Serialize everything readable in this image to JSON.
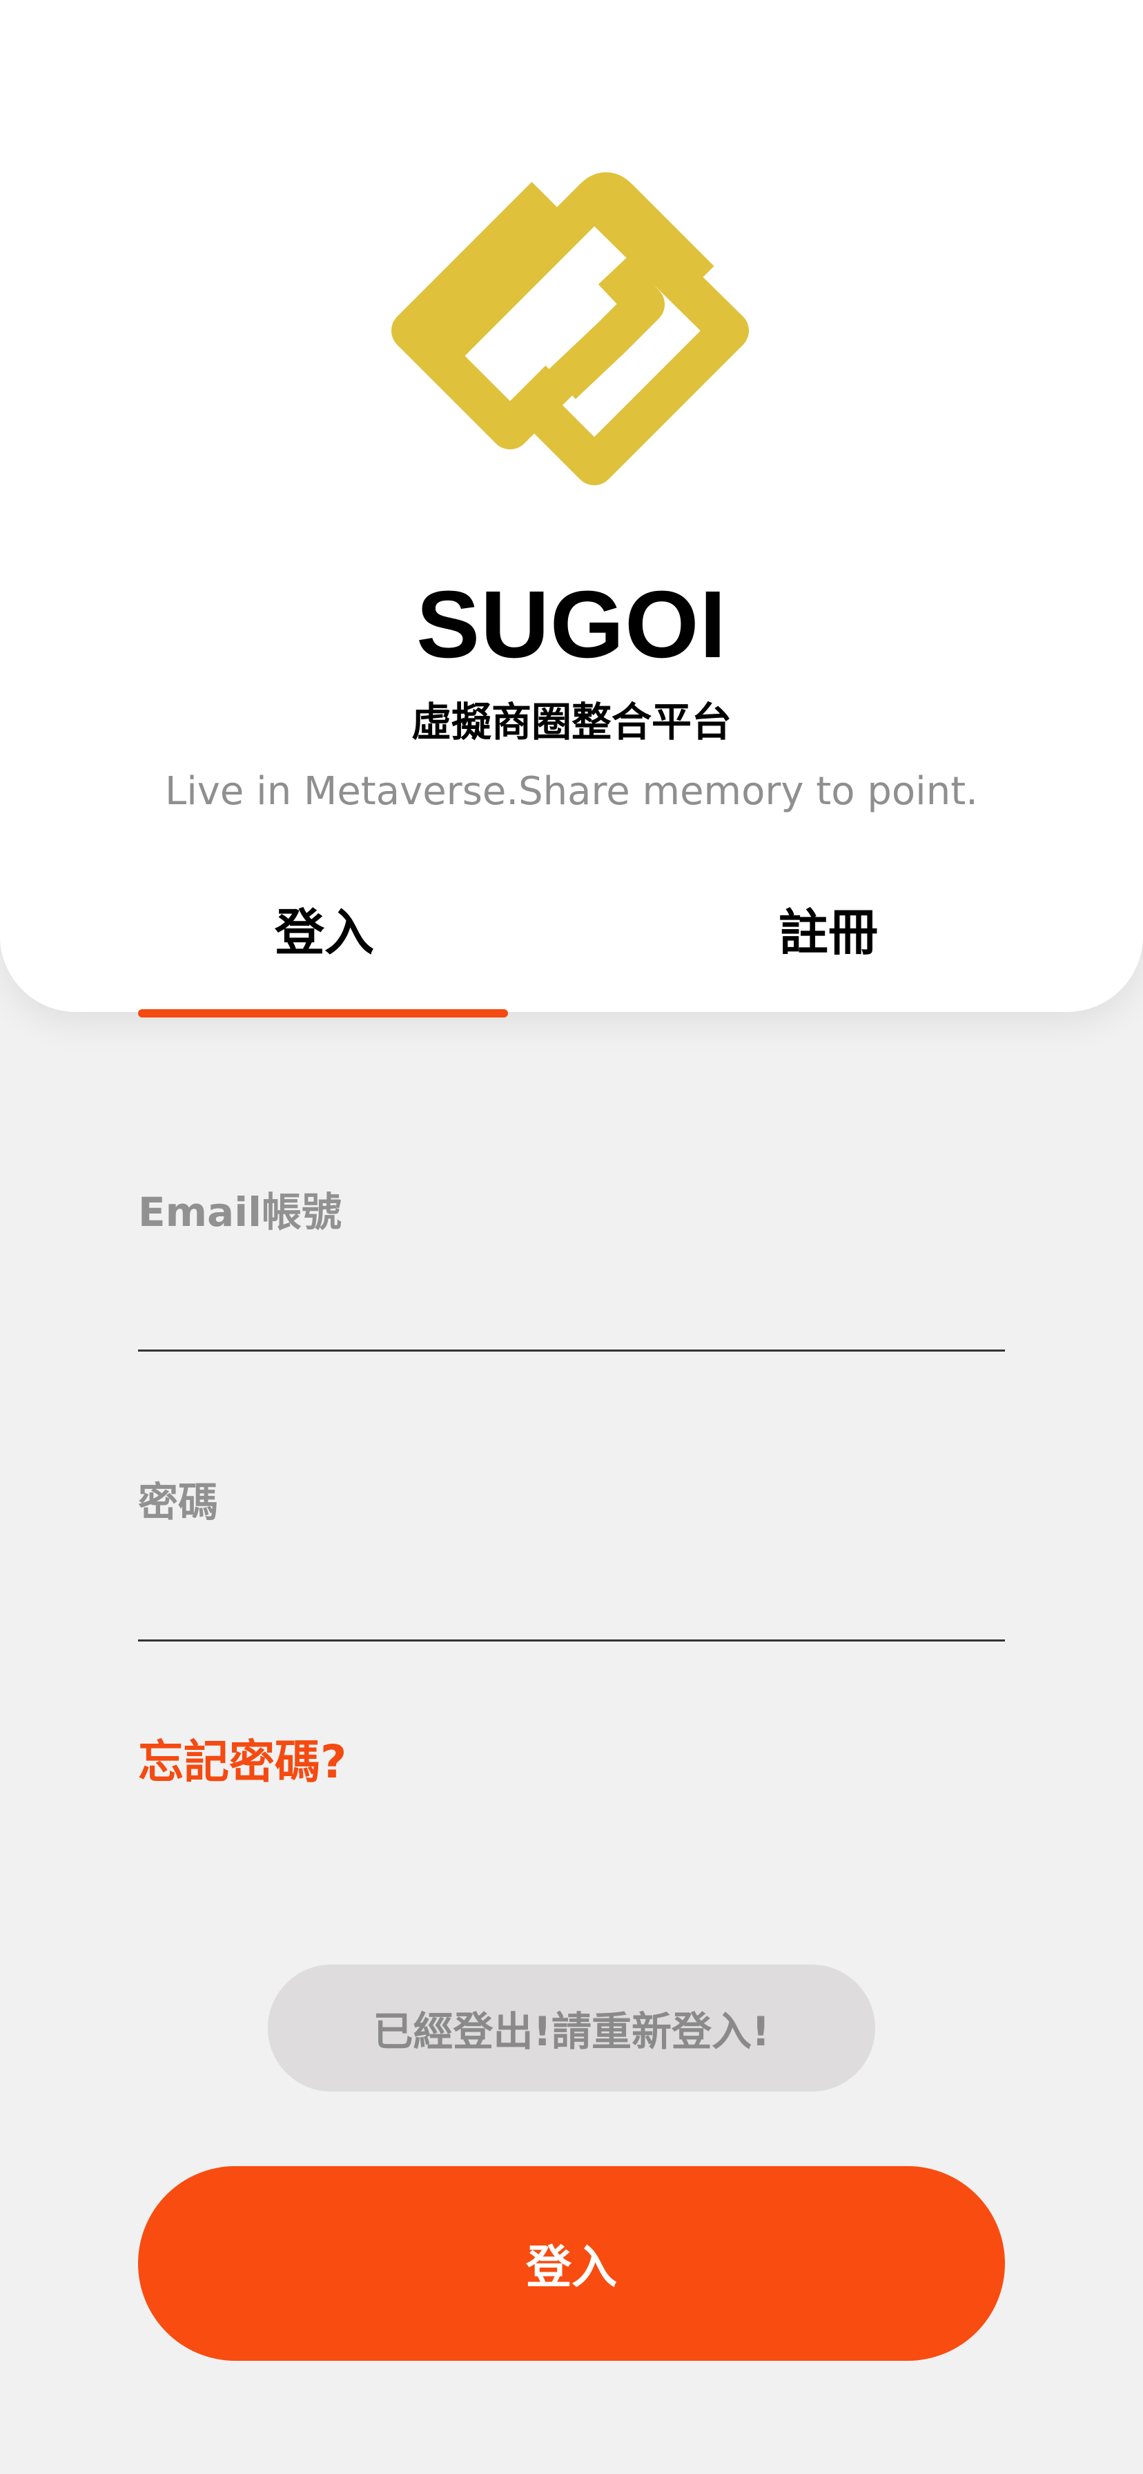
{
  "brand": {
    "title": "SUGOI",
    "subtitle": "虛擬商圈整合平台",
    "tagline": "Live in Metaverse.Share memory to point.",
    "logo_icon": "sugoi-interlocked-diamonds-logo",
    "logo_color": "#dfc13c"
  },
  "tabs": [
    {
      "label": "登入",
      "active": true
    },
    {
      "label": "註冊",
      "active": false
    }
  ],
  "form": {
    "email": {
      "label": "Email帳號",
      "value": "",
      "placeholder": ""
    },
    "password": {
      "label": "密碼",
      "value": "",
      "placeholder": ""
    },
    "forgot_password": "忘記密碼?"
  },
  "toast": {
    "message": "已經登出!請重新登入!"
  },
  "login_button": {
    "label": "登入"
  },
  "colors": {
    "accent": "#f54a11",
    "background": "#f1f1f1",
    "card": "#ffffff",
    "label_gray": "#919191",
    "toast_bg": "#dedcdc"
  }
}
